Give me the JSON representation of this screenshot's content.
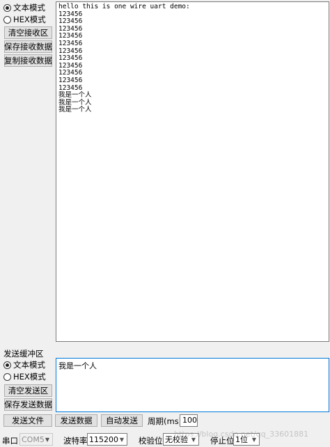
{
  "receive": {
    "mode_text": "文本模式",
    "mode_hex": "HEX模式",
    "clear_button": "清空接收区",
    "save_button": "保存接收数据",
    "copy_button": "复制接收数据",
    "content": "hello this is one wire uart demo:\n123456\n123456\n123456\n123456\n123456\n123456\n123456\n123456\n123456\n123456\n123456\n我是一个人\n我是一个人\n我是一个人"
  },
  "send": {
    "section_label": "发送缓冲区",
    "mode_text": "文本模式",
    "mode_hex": "HEX模式",
    "clear_button": "清空发送区",
    "save_button": "保存发送数据",
    "content": "我是一个人",
    "send_file_button": "发送文件",
    "send_data_button": "发送数据",
    "auto_send_button": "自动发送",
    "period_label": "周期(ms)",
    "period_value": "100"
  },
  "port": {
    "port_label": "串口",
    "port_value": "COM5",
    "baud_label": "波特率",
    "baud_value": "115200",
    "parity_label": "校验位",
    "parity_value": "无校验",
    "stop_label": "停止位",
    "stop_value": "1位"
  },
  "watermark": "https://blog.csdn.net/qq_33601881"
}
